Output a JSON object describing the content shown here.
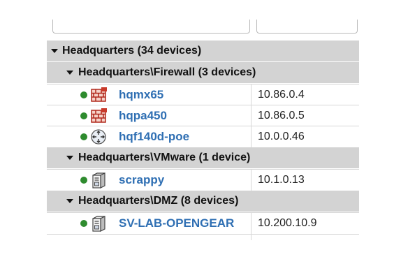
{
  "groups": {
    "hq": {
      "label": "Headquarters (34 devices)"
    },
    "firewall": {
      "label": "Headquarters\\Firewall (3 devices)"
    },
    "vmware": {
      "label": "Headquarters\\VMware (1 device)"
    },
    "dmz": {
      "label": "Headquarters\\DMZ (8 devices)"
    }
  },
  "devices": [
    {
      "name": "hqmx65",
      "ip": "10.86.0.4",
      "icon": "firewall-icon",
      "status": "up"
    },
    {
      "name": "hqpa450",
      "ip": "10.86.0.5",
      "icon": "firewall-icon",
      "status": "up"
    },
    {
      "name": "hqf140d-poe",
      "ip": "10.0.0.46",
      "icon": "router-icon",
      "status": "up"
    },
    {
      "name": "scrappy",
      "ip": "10.1.0.13",
      "icon": "server-icon",
      "status": "up"
    },
    {
      "name": "SV-LAB-OPENGEAR",
      "ip": "10.200.10.9",
      "icon": "server-icon",
      "status": "up"
    }
  ],
  "colors": {
    "status_up": "#2e8b2e",
    "link": "#2f6fb3",
    "group_bg": "#d3d3d3"
  }
}
